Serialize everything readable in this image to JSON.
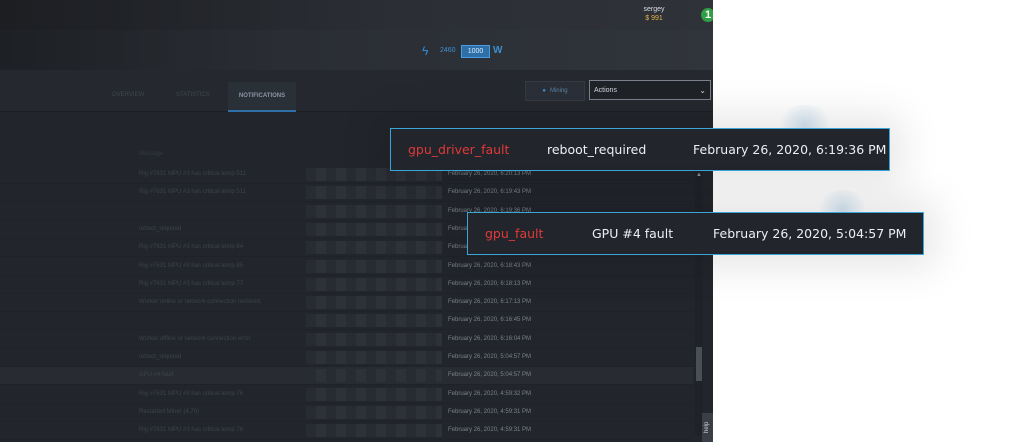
{
  "header": {
    "username": "sergey",
    "balance": "$ 991",
    "notification_count": "1"
  },
  "power": {
    "value": "2460",
    "limit": "1000",
    "unit": "W"
  },
  "tabs": [
    {
      "label": "Overview"
    },
    {
      "label": "Statistics"
    },
    {
      "label": "Notifications"
    }
  ],
  "controls": {
    "mining_label": "Mining",
    "actions_label": "Actions"
  },
  "list": {
    "header": "Message",
    "rows": [
      {
        "message": "Rig #7631 MPU #3 has critical temp 511",
        "time": "February 26, 2020, 6:20:13 PM"
      },
      {
        "message": "Rig #7631 MPU #3 has critical temp 511",
        "time": "February 26, 2020, 6:19:43 PM"
      },
      {
        "message": "",
        "time": "February 26, 2020, 6:19:36 PM"
      },
      {
        "message": "reboot_required",
        "time": "February 26, 2020, 6:19:36 PM"
      },
      {
        "message": "Rig #7631 MPU #3 has critical temp 84",
        "time": "February 26, 2020, 6:19:13 PM"
      },
      {
        "message": "Rig #7631 MPU #3 has critical temp 85",
        "time": "February 26, 2020, 6:18:43 PM"
      },
      {
        "message": "Rig #7631 MPU #3 has critical temp 77",
        "time": "February 26, 2020, 6:18:13 PM"
      },
      {
        "message": "Worker online or network connection restored.",
        "time": "February 26, 2020, 6:17:13 PM"
      },
      {
        "message": "",
        "time": "February 26, 2020, 6:16:45 PM"
      },
      {
        "message": "Worker offline or network connection error",
        "time": "February 26, 2020, 6:16:04 PM"
      },
      {
        "message": "reboot_required",
        "time": "February 26, 2020, 5:04:57 PM"
      },
      {
        "message": "GPU #4 fault",
        "time": "February 26, 2020, 5:04:57 PM"
      },
      {
        "message": "Rig #7631 MPU #3 has critical temp 76",
        "time": "February 26, 2020, 4:59:32 PM"
      },
      {
        "message": "Restarted Miner (4.70)",
        "time": "February 26, 2020, 4:59:31 PM"
      },
      {
        "message": "Rig #7631 MPU #3 has critical temp 76",
        "time": "February 26, 2020, 4:59:31 PM"
      }
    ]
  },
  "help_label": "help",
  "tooltips": [
    {
      "type": "gpu_driver_fault",
      "text": "reboot_required",
      "time": "February 26, 2020, 6:19:36 PM"
    },
    {
      "type": "gpu_fault",
      "text": "GPU #4 fault",
      "time": "February 26, 2020, 5:04:57 PM"
    }
  ],
  "colors": {
    "accent": "#3aa6d8",
    "error": "#e03a3a",
    "badge": "#2f9e44"
  }
}
